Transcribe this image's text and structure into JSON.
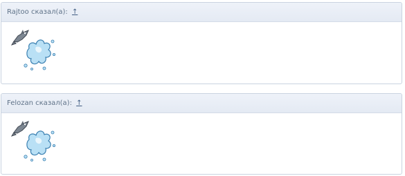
{
  "quotes": [
    {
      "author_label": "Rajtoo сказал(а): ",
      "up_link": "↑",
      "image_icon": "fish-splash-smiley"
    },
    {
      "author_label": "Felozan сказал(а): ",
      "up_link": "↑",
      "image_icon": "fish-splash-smiley"
    }
  ],
  "colors": {
    "header_bg": "#e7ecf4",
    "border": "#c9d3e0",
    "header_text": "#5f7288",
    "link": "#3d5a80",
    "splash": "#a9d8f2",
    "fish": "#7c8691"
  }
}
